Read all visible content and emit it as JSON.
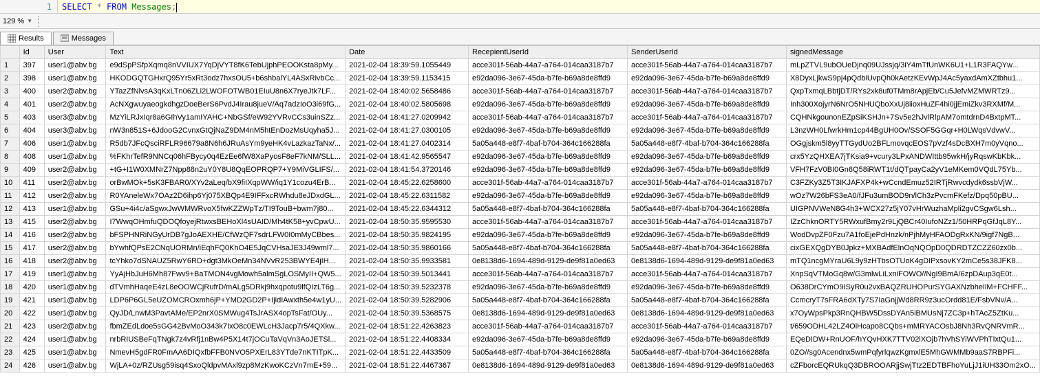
{
  "query": {
    "line_number": "1",
    "tokens": {
      "select": "SELECT",
      "star": " * ",
      "from": "FROM",
      "space": " ",
      "table": "Messages",
      "semi": ";"
    }
  },
  "zoom": {
    "value": "129 %"
  },
  "tabs": {
    "results": "Results",
    "messages": "Messages"
  },
  "columns": {
    "rownum": "",
    "id": "Id",
    "user": "User",
    "text": "Text",
    "date": "Date",
    "recip": "RecepientUserId",
    "sender": "SenderUserId",
    "signed": "signedMessage"
  },
  "rows": [
    {
      "n": "1",
      "id": "397",
      "user": "user1@abv.bg",
      "text": "e9dSpPSfpXqmq8nVVIUX7YqDjVYT8fK6TebUjphPEOOKsta8pMy...",
      "date": "2021-02-04 18:39:59.1055449",
      "recip": "acce301f-56ab-44a7-a764-014caa3187b7",
      "sender": "acce301f-56ab-44a7-a764-014caa3187b7",
      "signed": "mLpZTVL9ubOUeDjnq09UJssjq/3iY4mTfUnWK6U1+L1R3FAQYw..."
    },
    {
      "n": "2",
      "id": "398",
      "user": "user1@abv.bg",
      "text": "HKODGQTGHxrQ95Yr5xRt3odz7hxsOU5+b6shbalYL4ASxRivbCc...",
      "date": "2021-02-04 18:39:59.1153415",
      "recip": "e92da096-3e67-45da-b7fe-b69a8de8ffd9",
      "sender": "e92da096-3e67-45da-b7fe-b69a8de8ffd9",
      "signed": "X8DyxLjkwS9pj4pQdbiUvpQh0kAetzKEvWpJ4Ac5yaxdAmXZtbhu1..."
    },
    {
      "n": "3",
      "id": "400",
      "user": "user2@abv.bg",
      "text": "YTazZfNlvsA3qKxLTn06ZLi2LWOFOTWB01EIuU8n6X7ryeJtk7LF...",
      "date": "2021-02-04 18:40:02.5658486",
      "recip": "acce301f-56ab-44a7-a764-014caa3187b7",
      "sender": "acce301f-56ab-44a7-a764-014caa3187b7",
      "signed": "QxpTxmqLBbtjDT/RYs2xk8uf0TMm8rApjEb/Cu5JefvMZMWRTz9..."
    },
    {
      "n": "4",
      "id": "401",
      "user": "user2@abv.bg",
      "text": "AcNXgwuyaeogkdhgzDoeBerS6PvdJ4Irau8jueV/Aq7adzIoO3i69fG...",
      "date": "2021-02-04 18:40:02.5805698",
      "recip": "e92da096-3e67-45da-b7fe-b69a8de8ffd9",
      "sender": "e92da096-3e67-45da-b7fe-b69a8de8ffd9",
      "signed": "Inh300XojyrN6NrO5NHUQboXxUj8iioxHuZF4hi0jjEmiZkv3RXMf/M..."
    },
    {
      "n": "5",
      "id": "403",
      "user": "user3@abv.bg",
      "text": "MzYiLRJxIqr8a6GIhVy1amIYAHC+NbGSf/eW92YVRvCCs3uinSZz...",
      "date": "2021-02-04 18:41:27.0209942",
      "recip": "acce301f-56ab-44a7-a764-014caa3187b7",
      "sender": "acce301f-56ab-44a7-a764-014caa3187b7",
      "signed": "CQHNkgounonEZpSiKSHJn+7Sv5e2hJvlRlpAM7omtdrnD4BxtpMT..."
    },
    {
      "n": "6",
      "id": "404",
      "user": "user3@abv.bg",
      "text": "nW3n851S+6JdooG2CvnxGtQjNaZ9DM4nM5htEnDozMsUqyha5J...",
      "date": "2021-02-04 18:41:27.0300105",
      "recip": "e92da096-3e67-45da-b7fe-b69a8de8ffd9",
      "sender": "e92da096-3e67-45da-b7fe-b69a8de8ffd9",
      "signed": "L3nzWH0LfwrkHm1cp44BgUH0Ov/SSOF5GGqr+H0LWqsVdvwV..."
    },
    {
      "n": "7",
      "id": "406",
      "user": "user1@abv.bg",
      "text": "R5db7JFcQsciRFLR96679a8N6h6JRuAsYm9yeHK4vLazkazTaNx/...",
      "date": "2021-02-04 18:41:27.0402314",
      "recip": "5a05a448-e8f7-4baf-b704-364c166288fa",
      "sender": "5a05a448-e8f7-4baf-b704-364c166288fa",
      "signed": "OGgjskm5l8yyTTGydUo2BFLmovqcEOS7pVzf4sDcBXH7m0yVqno..."
    },
    {
      "n": "8",
      "id": "408",
      "user": "user1@abv.bg",
      "text": "%FKhrTefR9NNCq06hFBycy0q4EzEe6fW8XaPyosF8eF7kNM/SLL...",
      "date": "2021-02-04 18:41:42.9565547",
      "recip": "e92da096-3e67-45da-b7fe-b69a8de8ffd9",
      "sender": "e92da096-3e67-45da-b7fe-b69a8de8ffd9",
      "signed": "crx5YzQHXEA7jTKsia9+vcury3LPxANDWIttb95wkH/jyRqswKbKbk..."
    },
    {
      "n": "9",
      "id": "409",
      "user": "user2@abv.bg",
      "text": "+tG+I1W0XMNrZ7Npp88n2uY0Y8U8QqEOPRQP7+Y9MiVGLIFS/...",
      "date": "2021-02-04 18:41:54.3720146",
      "recip": "e92da096-3e67-45da-b7fe-b69a8de8ffd9",
      "sender": "e92da096-3e67-45da-b7fe-b69a8de8ffd9",
      "signed": "VFH7FzV0BI0Gn6Q58iRWT1t/dQTpayCa2yV1eMKem0VQdL75Yb..."
    },
    {
      "n": "10",
      "id": "411",
      "user": "user2@abv.bg",
      "text": "orBwMOk+5sK3FBAR0/XYv2aLeq/bX9fiIXqpWW/iq1Y1cozu4ErB...",
      "date": "2021-02-04 18:45:22.6258600",
      "recip": "acce301f-56ab-44a7-a764-014caa3187b7",
      "sender": "acce301f-56ab-44a7-a764-014caa3187b7",
      "signed": "C3FZKy3Z5T3IKJAFXP4k+wCcndEmuz52IRTjRwvcdydk6ssbVjW..."
    },
    {
      "n": "11",
      "id": "412",
      "user": "user2@abv.bg",
      "text": "R0YAneleWx7OAz2D6ihp6Yj075XBQp4E9IFFxcRWhdu8eJDxdGL...",
      "date": "2021-02-04 18:45:22.6311582",
      "recip": "e92da096-3e67-45da-b7fe-b69a8de8ffd9",
      "sender": "e92da096-3e67-45da-b7fe-b69a8de8ffd9",
      "signed": "wOz7W26bFS3eA0/fJFu3umBOD9n/lCh3zPvcmFKefz/Dpq50pBU..."
    },
    {
      "n": "12",
      "id": "413",
      "user": "user1@abv.bg",
      "text": "GSu+4i4c/aSgwxJwWMWRvoX5fwKZZWpTz/TI9TouB+bwm7j80...",
      "date": "2021-02-04 18:45:22.6344312",
      "recip": "5a05a448-e8f7-4baf-b704-364c166288fa",
      "sender": "5a05a448-e8f7-4baf-b704-364c166288fa",
      "signed": "UIGPNVWeN8G4h3+WCX27z5jY07vHrWuzhaMpli2gvCSgw6Lsh..."
    },
    {
      "n": "13",
      "id": "415",
      "user": "user2@abv.bg",
      "text": "I7WwqOHmfuQDOQfoyejRtwxsBEHoXl4sUAID/Mh4tK58+yvCpwU...",
      "date": "2021-02-04 18:50:35.9595530",
      "recip": "acce301f-56ab-44a7-a764-014caa3187b7",
      "sender": "acce301f-56ab-44a7-a764-014caa3187b7",
      "signed": "IZzChknORTY5RWxufBmy2r9LjQBCr40IufoNZz1/50HRPqGfJqL8Y..."
    },
    {
      "n": "14",
      "id": "416",
      "user": "user2@abv.bg",
      "text": "bFSPHNRiNGyUrDB7gJoAEXHE/CfWzQF7sdrLFW0I0mMyCBbes...",
      "date": "2021-02-04 18:50:35.9824195",
      "recip": "e92da096-3e67-45da-b7fe-b69a8de8ffd9",
      "sender": "e92da096-3e67-45da-b7fe-b69a8de8ffd9",
      "signed": "WodDvpZF0Fzu7A1foEjePdHnzk/nPjhMyHFAODgRxKN/9igf7NgB..."
    },
    {
      "n": "15",
      "id": "417",
      "user": "user2@abv.bg",
      "text": "bYwhfQPsE2CNqUORMn/iEqhFQ0KhO4E5JqCVHsaJE3J49wml7...",
      "date": "2021-02-04 18:50:35.9860166",
      "recip": "5a05a448-e8f7-4baf-b704-364c166288fa",
      "sender": "5a05a448-e8f7-4baf-b704-364c166288fa",
      "signed": "cixGEXQgDYB0Jpkz+MXBAdfElnOqNQOpD0QDRDTZCZZ60zx0b..."
    },
    {
      "n": "16",
      "id": "418",
      "user": "user2@abv.bg",
      "text": "tcYhko7dSNAUZ5RwY6RD+dgt3MkOeMn34NVvR253BWYE4jIH...",
      "date": "2021-02-04 18:50:35.9933581",
      "recip": "0e8138d6-1694-489d-9129-de9f81a0ed63",
      "sender": "0e8138d6-1694-489d-9129-de9f81a0ed63",
      "signed": "mTQ1ncgMYraU6L9y9zHTbsOTUoK4gDIPxsovKY2mCe5s38JFK8..."
    },
    {
      "n": "17",
      "id": "419",
      "user": "user1@abv.bg",
      "text": "YyAjHbJuH6Mh87Fwv9+BaTMON4vgMowh5almSgLOSMyII+QW5...",
      "date": "2021-02-04 18:50:39.5013441",
      "recip": "acce301f-56ab-44a7-a764-014caa3187b7",
      "sender": "acce301f-56ab-44a7-a764-014caa3187b7",
      "signed": "XnpSqVTMoGq8w/G3mlwLiLxniFOWO//NgI9BmA/6zpDAup3qE0t..."
    },
    {
      "n": "18",
      "id": "420",
      "user": "user1@abv.bg",
      "text": "dTVmhHaqeE4zL8eOOWCjRufrD/mALg5DRkj9hxqpotu9lfQIzLT6g...",
      "date": "2021-02-04 18:50:39.5232378",
      "recip": "e92da096-3e67-45da-b7fe-b69a8de8ffd9",
      "sender": "e92da096-3e67-45da-b7fe-b69a8de8ffd9",
      "signed": "O638DrCYmO9ISyR0u2vxBAQZRUHOPurSYGAXNzbheIlM+FCHFF..."
    },
    {
      "n": "19",
      "id": "421",
      "user": "user1@abv.bg",
      "text": "LDP6P6GL5eUZOMCROxmh6jP+YMD2GD2P+IjidIAwxth5e4w1yU...",
      "date": "2021-02-04 18:50:39.5282906",
      "recip": "5a05a448-e8f7-4baf-b704-364c166288fa",
      "sender": "5a05a448-e8f7-4baf-b704-364c166288fa",
      "signed": "CcmcryT7sFRA6dXTy7S7IaGnjjWd8RR9z3ucOrdd81E/FsbVNv/A..."
    },
    {
      "n": "20",
      "id": "422",
      "user": "user1@abv.bg",
      "text": "QyJD/LnwM3PavtAMe/EP2nrX0SMWug4TsJrASX4opTsFat/OUy...",
      "date": "2021-02-04 18:50:39.5368575",
      "recip": "0e8138d6-1694-489d-9129-de9f81a0ed63",
      "sender": "0e8138d6-1694-489d-9129-de9f81a0ed63",
      "signed": "x7OyWpsPkp3RnQHBW5DssDYAn5iBMUsNj7ZC3p+hTAcZ5ZtKu..."
    },
    {
      "n": "21",
      "id": "423",
      "user": "user2@abv.bg",
      "text": "fbmZEdLdoe5sGG42BvMoO343k7IxO8c0EWLcH3Jacp7r5/4QXkw...",
      "date": "2021-02-04 18:51:22.4263823",
      "recip": "acce301f-56ab-44a7-a764-014caa3187b7",
      "sender": "acce301f-56ab-44a7-a764-014caa3187b7",
      "signed": "t/659ODHL42LZ4OiHcapo8CQbs+mMRYACOsbJ8Nh3RvQNRVmR..."
    },
    {
      "n": "22",
      "id": "424",
      "user": "user1@abv.bg",
      "text": "nrbRIUSBeFqTNgk7z4vRfj1nBw4P5X14t7jOCuTaVqVn3AoJETSl...",
      "date": "2021-02-04 18:51:22.4408334",
      "recip": "e92da096-3e67-45da-b7fe-b69a8de8ffd9",
      "sender": "e92da096-3e67-45da-b7fe-b69a8de8ffd9",
      "signed": "EQeDIDW+RnUOF/hYQvHXK7TTV02lXOjb7hVhSYiWVPhTIxtQu1..."
    },
    {
      "n": "23",
      "id": "425",
      "user": "user1@abv.bg",
      "text": "NmevH5gdFR0FmAA6DIQxfbFFB0NVO5PXErL83YTde7nKTITpK...",
      "date": "2021-02-04 18:51:22.4433509",
      "recip": "5a05a448-e8f7-4baf-b704-364c166288fa",
      "sender": "5a05a448-e8f7-4baf-b704-364c166288fa",
      "signed": "0ZO//sg0Acendnx5wmPqfyrlqwzKgmxlE5MhGWMMb9aaS7RBPFi..."
    },
    {
      "n": "24",
      "id": "426",
      "user": "user1@abv.bg",
      "text": "WjLA+0z/RZUsg59isq4SxoQldpvMAxl9zp8MzKwoKCzVn7mE+59...",
      "date": "2021-02-04 18:51:22.4467367",
      "recip": "0e8138d6-1694-489d-9129-de9f81a0ed63",
      "sender": "0e8138d6-1694-489d-9129-de9f81a0ed63",
      "signed": "cZFborcEQRUkqQ3DBROOARjjSwjTtz2EDTBFhoYuLjJ1iUH33Om2xO..."
    }
  ]
}
